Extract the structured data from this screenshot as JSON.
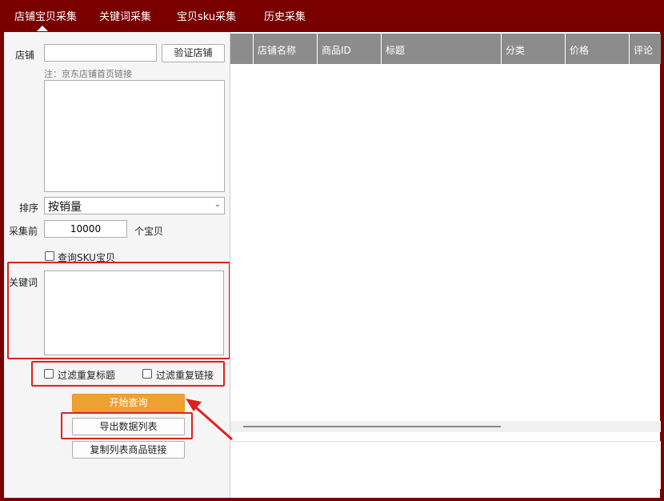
{
  "tabs": [
    {
      "label": "店铺宝贝采集",
      "active": true
    },
    {
      "label": "关键词采集"
    },
    {
      "label": "宝贝sku采集"
    },
    {
      "label": "历史采集"
    }
  ],
  "left": {
    "shop_label": "店铺",
    "shop_value": "",
    "verify_button": "验证店铺",
    "note": "注：京东店铺首页链接",
    "sort_label": "排序",
    "sort_value": "按销量",
    "collect_prefix": "采集前",
    "collect_count": "10000",
    "collect_suffix": "个宝贝",
    "query_sku_label": "查询SKU宝贝",
    "keyword_label": "关键词",
    "filter_title_label": "过滤重复标题",
    "filter_link_label": "过滤重复链接",
    "start_button": "开始查询",
    "export_button": "导出数据列表",
    "copy_button": "复制列表商品链接"
  },
  "grid": {
    "columns": [
      "",
      "店铺名称",
      "商品ID",
      "标题",
      "分类",
      "价格",
      "评论"
    ]
  },
  "colors": {
    "brand": "#7a0000",
    "header": "#8c8c8c",
    "accent": "#f0a030",
    "highlight": "#e02020"
  }
}
